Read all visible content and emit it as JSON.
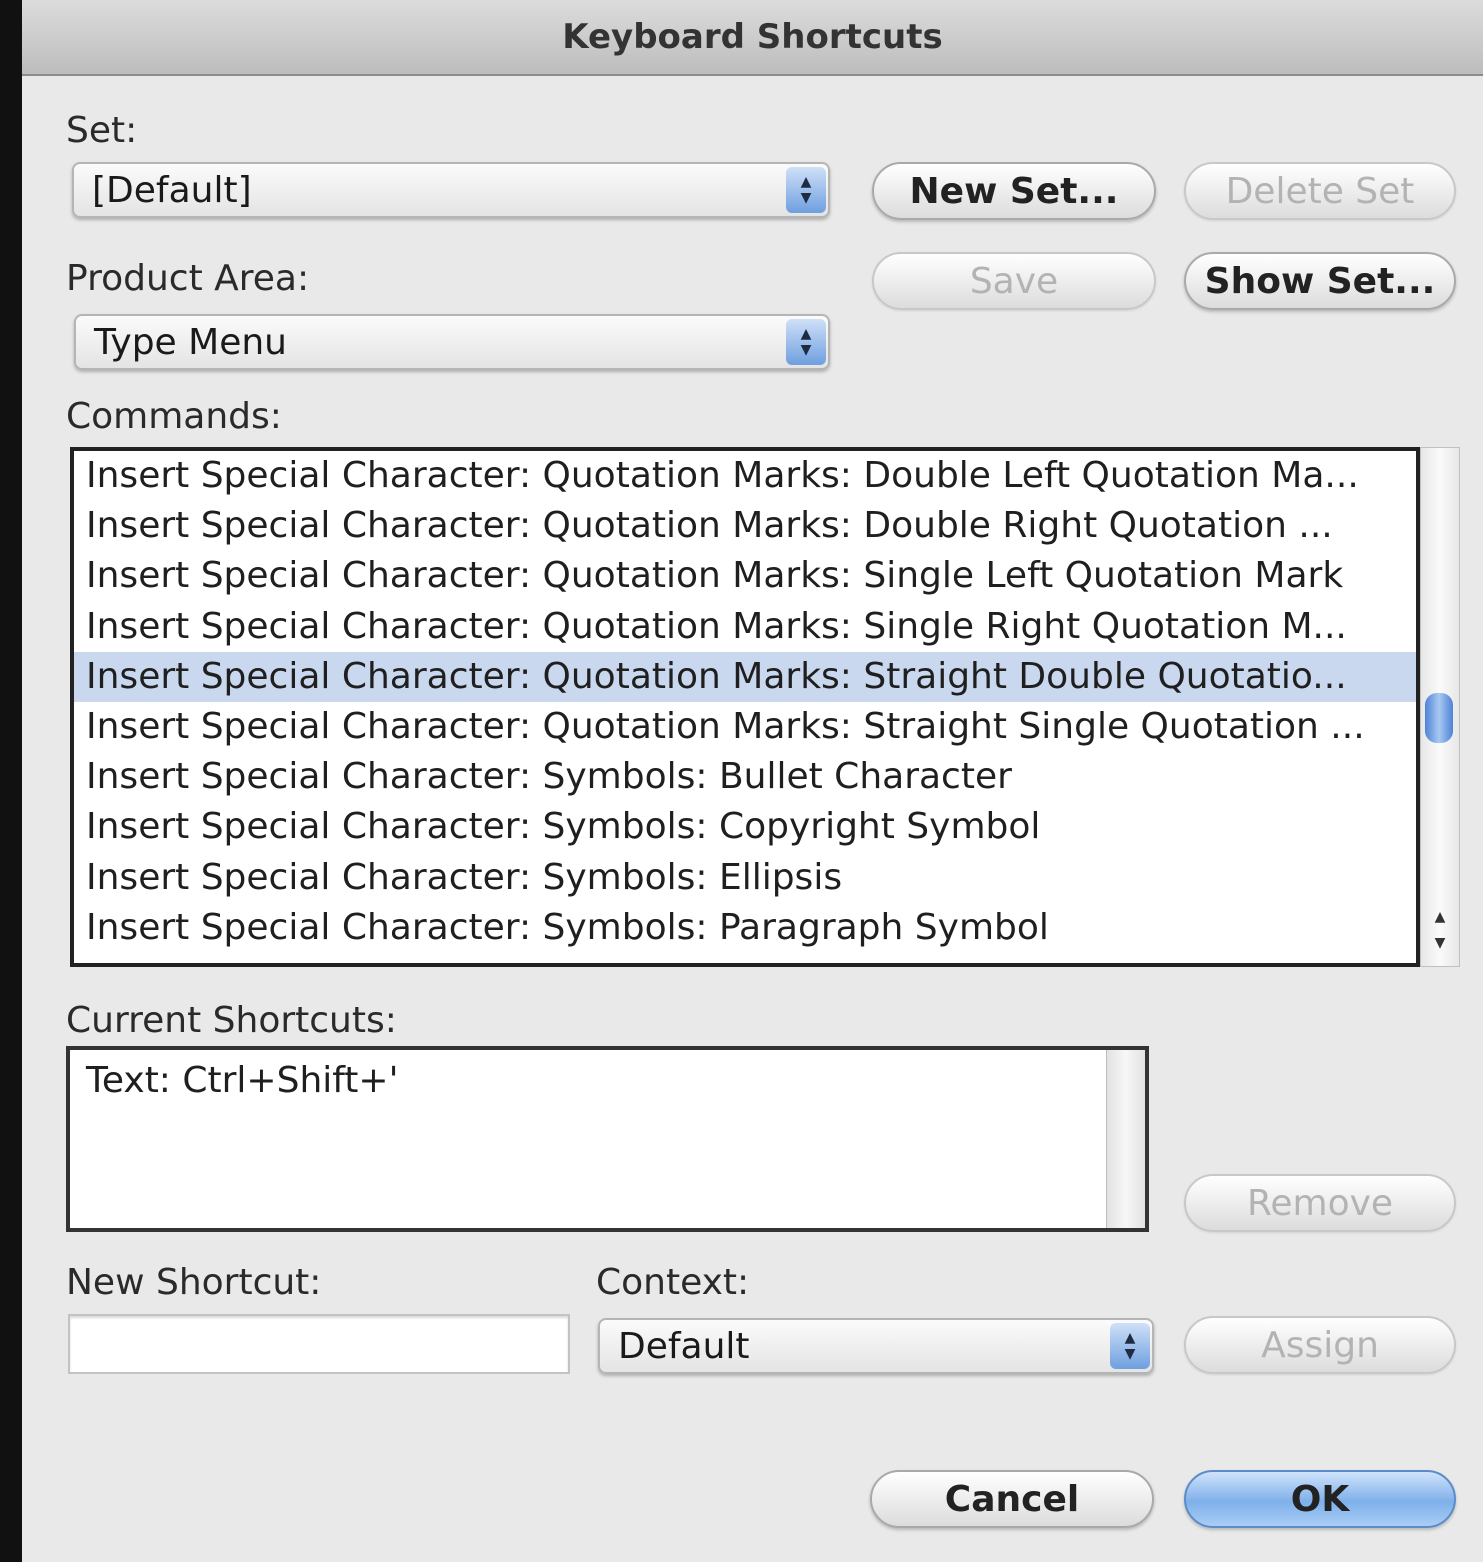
{
  "dialog": {
    "title": "Keyboard Shortcuts"
  },
  "set": {
    "label": "Set:",
    "value": "[Default]",
    "new_set_button": "New Set...",
    "delete_set_button": "Delete Set",
    "save_button": "Save",
    "show_set_button": "Show Set..."
  },
  "product_area": {
    "label": "Product Area:",
    "value": "Type Menu"
  },
  "commands": {
    "label": "Commands:",
    "items": [
      "Insert Special Character: Quotation Marks: Double Left Quotation Ma...",
      "Insert Special Character: Quotation Marks: Double Right Quotation ...",
      "Insert Special Character: Quotation Marks: Single Left Quotation Mark",
      "Insert Special Character: Quotation Marks: Single Right Quotation M...",
      "Insert Special Character: Quotation Marks: Straight Double Quotatio...",
      "Insert Special Character: Quotation Marks: Straight Single Quotation ...",
      "Insert Special Character: Symbols: Bullet Character",
      "Insert Special Character: Symbols: Copyright Symbol",
      "Insert Special Character: Symbols: Ellipsis",
      "Insert Special Character: Symbols: Paragraph Symbol"
    ],
    "selected_index": 4
  },
  "current_shortcuts": {
    "label": "Current Shortcuts:",
    "items": [
      "Text: Ctrl+Shift+'"
    ],
    "remove_button": "Remove"
  },
  "new_shortcut": {
    "label": "New Shortcut:",
    "value": ""
  },
  "context": {
    "label": "Context:",
    "value": "Default",
    "assign_button": "Assign"
  },
  "footer": {
    "cancel_button": "Cancel",
    "ok_button": "OK"
  },
  "icons": {
    "popup_stepper": "up-down-arrows-icon",
    "scroll_arrows": "scroll-arrows-icon"
  },
  "colors": {
    "selection": "#c9d8ee",
    "default_button": "#7fb0ea"
  }
}
